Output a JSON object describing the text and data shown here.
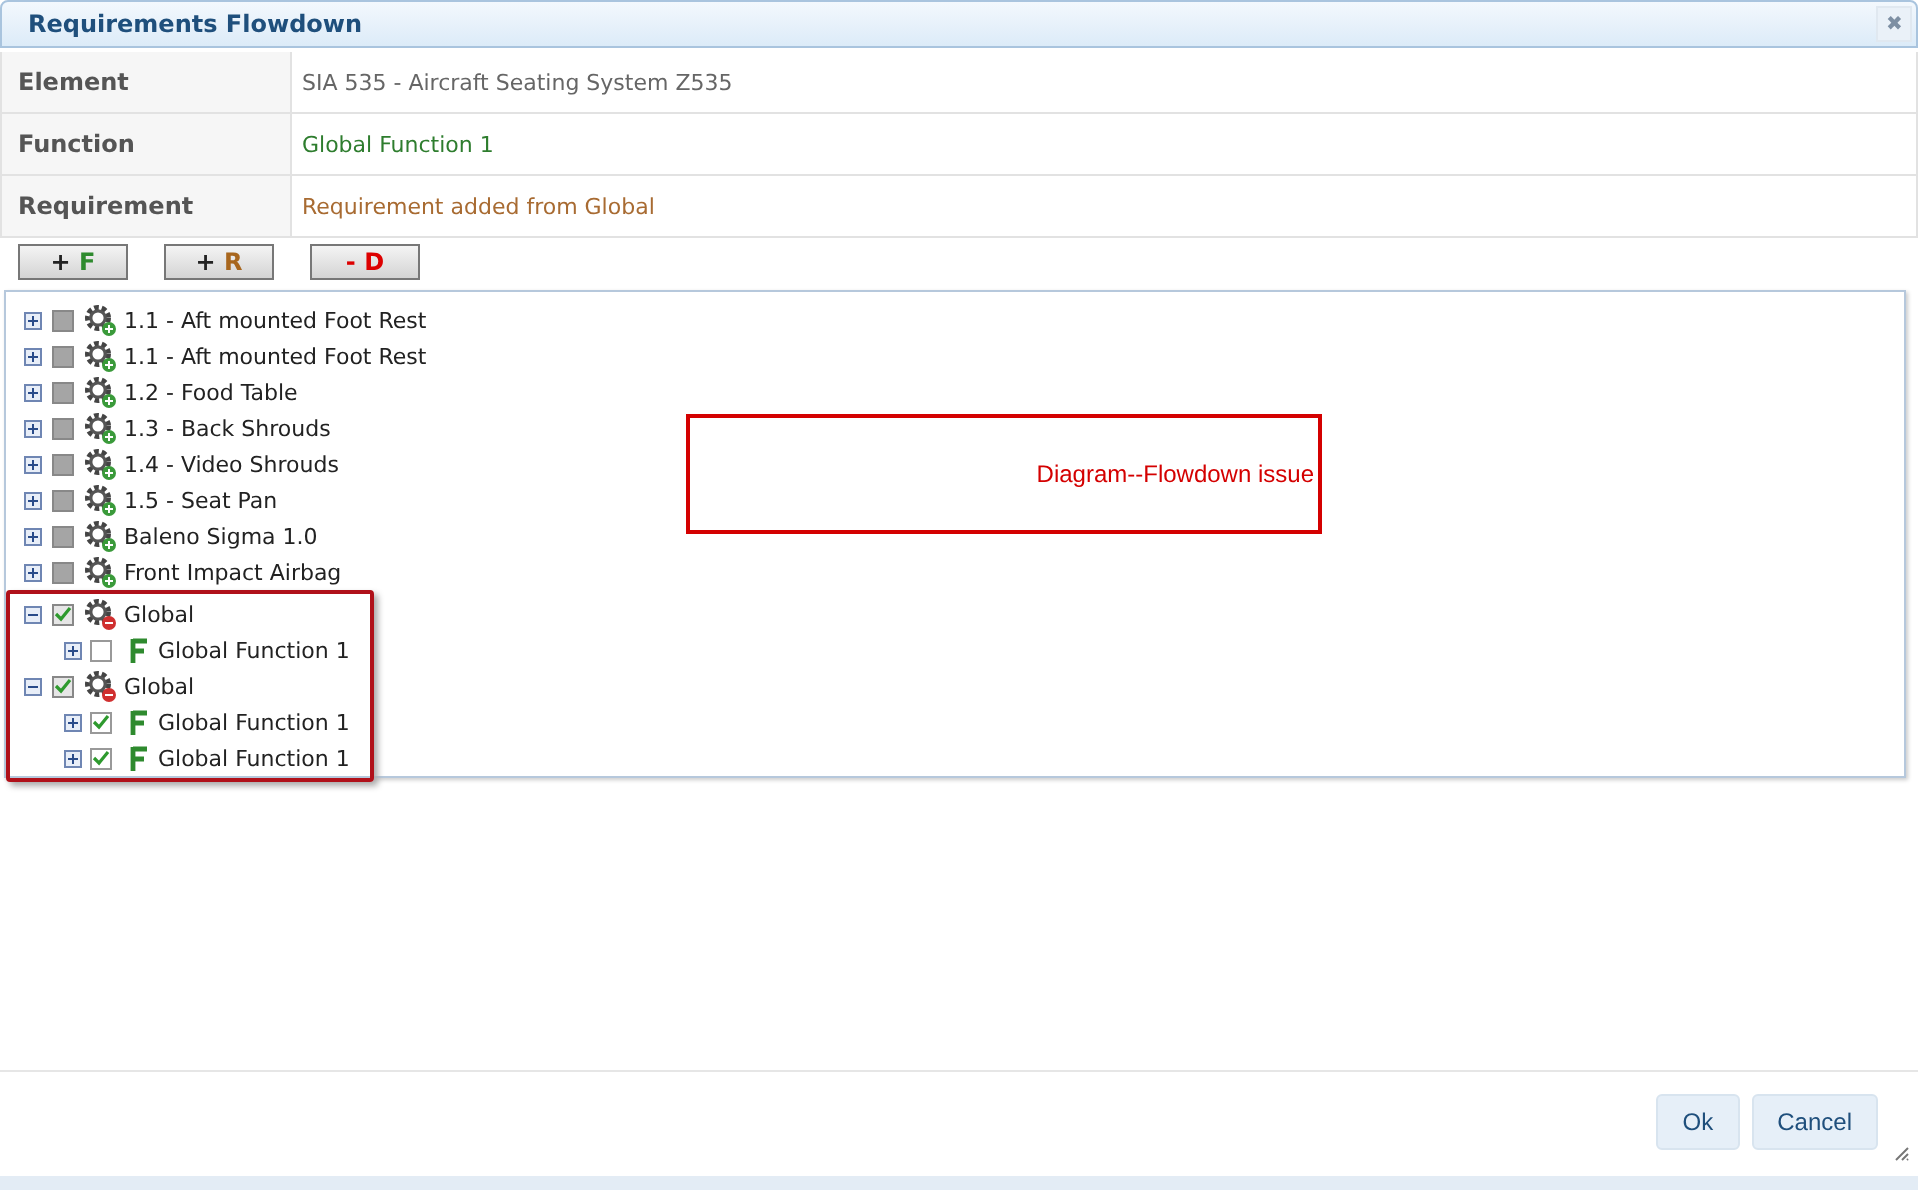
{
  "window": {
    "title": "Requirements Flowdown",
    "close": "✖"
  },
  "details": [
    {
      "label": "Element",
      "value": "SIA 535 - Aircraft Seating System Z535",
      "kind": "plain"
    },
    {
      "label": "Function",
      "value": "Global Function 1",
      "kind": "function"
    },
    {
      "label": "Requirement",
      "value": "Requirement added from Global",
      "kind": "requirement"
    }
  ],
  "toolbar": [
    {
      "sign": "+",
      "letter": "F",
      "kind": "function"
    },
    {
      "sign": "+",
      "letter": "R",
      "kind": "requirement"
    },
    {
      "sign": "-",
      "letter": "D",
      "kind": "delete"
    }
  ],
  "tree": [
    {
      "label": "1.1 - Aft mounted Foot Rest",
      "kind": "gear-add",
      "expanded": false,
      "checked": false,
      "disabled": true,
      "highlighted": false
    },
    {
      "label": "1.1 - Aft mounted Foot Rest",
      "kind": "gear-add",
      "expanded": false,
      "checked": false,
      "disabled": true,
      "highlighted": false
    },
    {
      "label": "1.2 - Food Table",
      "kind": "gear-add",
      "expanded": false,
      "checked": false,
      "disabled": true,
      "highlighted": false
    },
    {
      "label": "1.3 - Back Shrouds",
      "kind": "gear-add",
      "expanded": false,
      "checked": false,
      "disabled": true,
      "highlighted": false
    },
    {
      "label": "1.4 - Video Shrouds",
      "kind": "gear-add",
      "expanded": false,
      "checked": false,
      "disabled": true,
      "highlighted": false
    },
    {
      "label": "1.5 - Seat Pan",
      "kind": "gear-add",
      "expanded": false,
      "checked": false,
      "disabled": true,
      "highlighted": false
    },
    {
      "label": "Baleno Sigma 1.0",
      "kind": "gear-add",
      "expanded": false,
      "checked": false,
      "disabled": true,
      "highlighted": false
    },
    {
      "label": "Front Impact Airbag",
      "kind": "gear-add",
      "expanded": false,
      "checked": false,
      "disabled": true,
      "highlighted": false
    },
    {
      "label": "Global",
      "kind": "gear-remove",
      "expanded": true,
      "checked": true,
      "disabled": true,
      "highlighted": true,
      "children": [
        {
          "label": "Global Function 1",
          "kind": "function",
          "expanded": false,
          "checked": false,
          "disabled": false
        }
      ]
    },
    {
      "label": "Global",
      "kind": "gear-remove",
      "expanded": true,
      "checked": true,
      "disabled": true,
      "highlighted": true,
      "children": [
        {
          "label": "Global Function 1",
          "kind": "function",
          "expanded": false,
          "checked": true,
          "disabled": false
        },
        {
          "label": "Global Function 1",
          "kind": "function",
          "expanded": false,
          "checked": true,
          "disabled": false
        }
      ]
    }
  ],
  "annotation": {
    "text": "Diagram--Flowdown issue"
  },
  "buttons": [
    "Ok",
    "Cancel"
  ]
}
